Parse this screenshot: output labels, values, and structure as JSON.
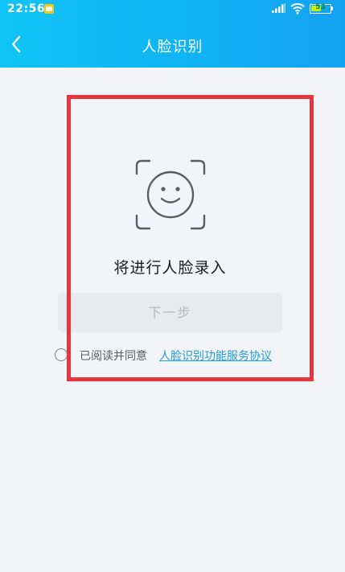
{
  "status_bar": {
    "time": "22:56",
    "battery_level": "53",
    "icons": [
      "notification-icon",
      "signal-icon",
      "wifi-icon",
      "battery-icon"
    ]
  },
  "nav": {
    "back_icon": "chevron-left-icon",
    "title": "人脸识别"
  },
  "main": {
    "face_icon": "face-scan-icon",
    "headline": "将进行人脸录入",
    "next_button_label": "下一步",
    "agreement_prefix": "已阅读并同意",
    "agreement_link": "人脸识别功能服务协议"
  },
  "colors": {
    "header_gradient_start": "#0fc4f6",
    "header_gradient_end": "#14a1f1",
    "background": "#f3f4f8",
    "disabled_button_bg": "#e9eaed",
    "disabled_button_text": "#b7b8bc",
    "link": "#1e9cdb",
    "highlight_border": "#e8343b"
  }
}
